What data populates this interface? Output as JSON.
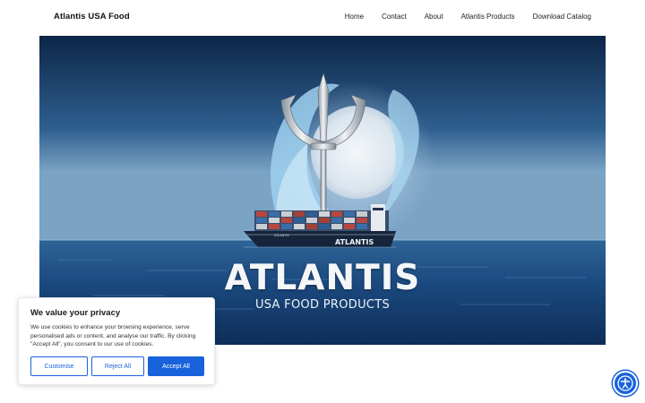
{
  "header": {
    "logo": "Atlantis USA Food",
    "nav": [
      {
        "label": "Home"
      },
      {
        "label": "Contact"
      },
      {
        "label": "About"
      },
      {
        "label": "Atlantis Products"
      },
      {
        "label": "Download Catalog"
      }
    ]
  },
  "hero": {
    "title": "ATLANTIS",
    "subtitle": "USA FOOD PRODUCTS",
    "ship_name": "ATLANTIS",
    "ship_bow_text": "ATLANTIS"
  },
  "cookie_banner": {
    "title": "We value your privacy",
    "text": "We use cookies to enhance your browsing experience, serve personalised ads or content, and analyse our traffic. By clicking \"Accept All\", you consent to our use of cookies.",
    "customise_label": "Customise",
    "reject_label": "Reject All",
    "accept_label": "Accept All"
  },
  "accessibility_widget": {
    "icon": "accessibility-icon"
  },
  "colors": {
    "accent": "#1863dc",
    "sky_top": "#0f2d52",
    "ocean": "#1b4a80"
  }
}
